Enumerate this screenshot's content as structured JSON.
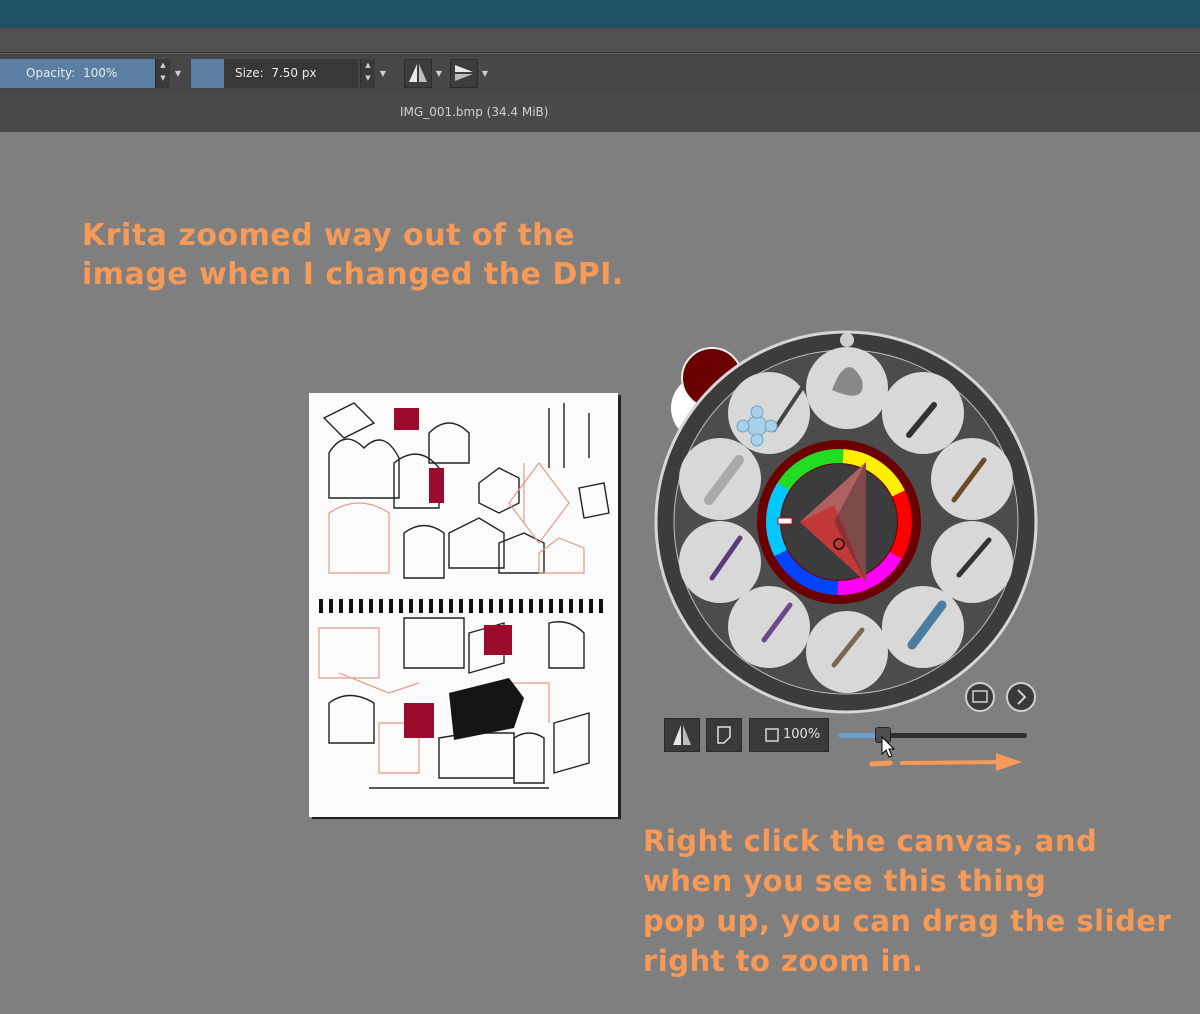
{
  "toolbar": {
    "opacity_label": "Opacity:",
    "opacity_value": "100%",
    "opacity_fraction": 1.0,
    "size_label": "Size:",
    "size_value": "7.50 px"
  },
  "document": {
    "tab_title": "IMG_001.bmp (34.4 MiB)"
  },
  "annotations": {
    "top_lines": [
      "Krita zoomed way out of the",
      "image when I changed the DPI."
    ],
    "bottom_lines": [
      "Right click the canvas, and",
      "when you see this thing",
      "pop up, you can drag the slider",
      "right to zoom in."
    ]
  },
  "popup_palette": {
    "zoom_label": "100%",
    "zoom_slider_fraction": 0.24,
    "foreground_color": "#6b0000",
    "background_color": "#ffffff",
    "brush_presets": [
      "airbrush-preset",
      "pencil-eraser-preset",
      "soft-brush-preset",
      "wet-paint-preset",
      "ink-pen-preset",
      "marker-preset",
      "bristle-brush-preset",
      "watercolor-brush-preset",
      "blender-brush-preset",
      "smudge-preset",
      "pen-nib-preset"
    ]
  },
  "colors": {
    "accent": "#f79a58",
    "titlebar": "#1d5163",
    "canvas_bg": "#7f7f7f",
    "slider_fill": "#6a9fd0"
  }
}
